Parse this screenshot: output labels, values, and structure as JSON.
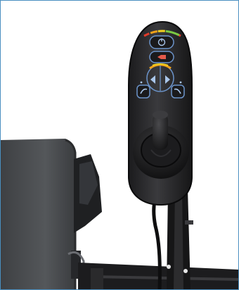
{
  "image": {
    "subject": "power-wheelchair-joystick-controller",
    "frame_color": "#4a8fc0",
    "background_color": "#ffffff"
  },
  "controller": {
    "panel_color": "#2a2a2c",
    "battery_gauge_colors": [
      "#e23b2a",
      "#f2a21a",
      "#f3d21f",
      "#7ac943"
    ],
    "button_ring_color": "#6b93c9",
    "speed_arc_colors": [
      "#f2a21a",
      "#f3d21f"
    ],
    "icons": [
      "power-icon",
      "horn-icon",
      "speed-down-icon",
      "speed-up-icon",
      "mode-left-icon",
      "mode-right-icon"
    ]
  },
  "seat": {
    "color": "#4b4d50"
  }
}
